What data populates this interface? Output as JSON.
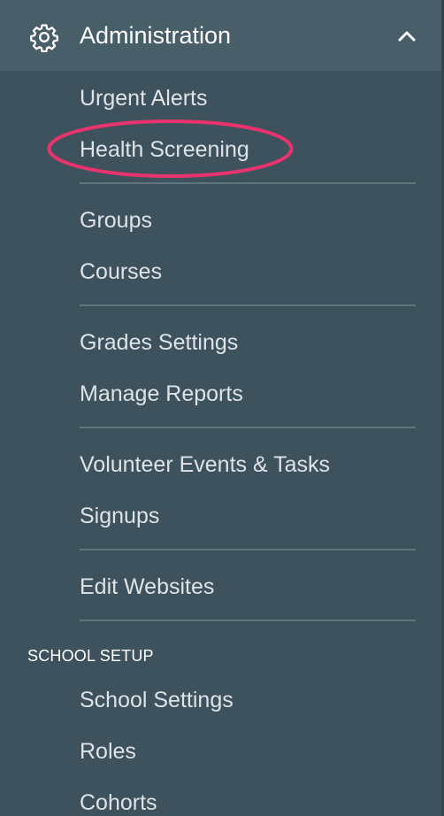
{
  "header": {
    "title": "Administration",
    "icon": "gear-icon",
    "toggle_icon": "chevron-up-icon"
  },
  "admin_items": [
    "Urgent Alerts",
    "Health Screening",
    "Groups",
    "Courses",
    "Grades Settings",
    "Manage Reports",
    "Volunteer Events & Tasks",
    "Signups",
    "Edit Websites"
  ],
  "section": {
    "title": "SCHOOL SETUP",
    "items": [
      "School Settings",
      "Roles",
      "Cohorts"
    ]
  },
  "colors": {
    "sidebar_bg": "#3d525c",
    "header_bg": "#485e68",
    "highlight_stroke": "#e8336e"
  }
}
